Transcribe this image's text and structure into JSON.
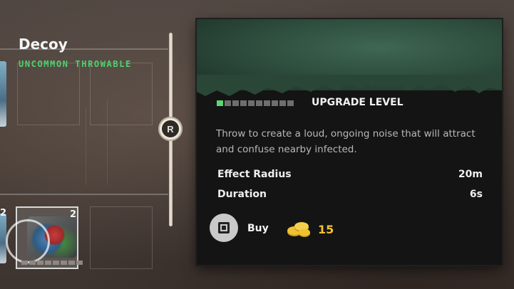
{
  "item": {
    "name": "Decoy",
    "rarity_type": "UNCOMMON THROWABLE",
    "upgrade_label": "UPGRADE LEVEL",
    "upgrade_level": 1,
    "upgrade_max": 10,
    "description": "Throw to create a loud, ongoing noise that will attract and confuse nearby infected.",
    "stats": [
      {
        "label": "Effect Radius",
        "value": "20m"
      },
      {
        "label": "Duration",
        "value": "6s"
      }
    ]
  },
  "buy": {
    "label": "Buy",
    "price": "15",
    "button_glyph": "square-button-icon",
    "currency_icon": "parts-coins-icon"
  },
  "inventory": {
    "selected_count": "2",
    "edge_count": "2"
  },
  "navigation": {
    "switch_button": "R"
  },
  "colors": {
    "accent_green": "#4ed26e",
    "price_gold": "#f0c232"
  }
}
